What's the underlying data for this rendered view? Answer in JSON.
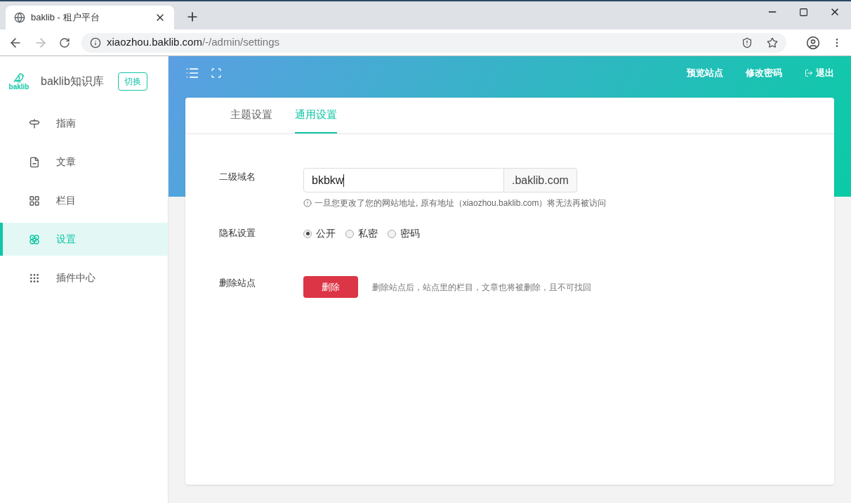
{
  "browser": {
    "tab_title": "baklib - 租户平台",
    "url_host": "xiaozhou.baklib.com",
    "url_path": "/-/admin/settings"
  },
  "sidebar": {
    "brand": "baklib知识库",
    "logo_text": "baklib",
    "switch_button": "切换",
    "items": [
      {
        "label": "指南",
        "kind": "guide",
        "selected": false
      },
      {
        "label": "文章",
        "kind": "article",
        "selected": false
      },
      {
        "label": "栏目",
        "kind": "columns",
        "selected": false
      },
      {
        "label": "设置",
        "kind": "settings",
        "selected": true
      },
      {
        "label": "插件中心",
        "kind": "plugins",
        "selected": false
      }
    ]
  },
  "header": {
    "links": [
      {
        "label": "预览站点",
        "kind": "plain"
      },
      {
        "label": "修改密码",
        "kind": "plain"
      },
      {
        "label": "退出",
        "kind": "logout"
      }
    ]
  },
  "tabs": [
    {
      "label": "主题设置",
      "selected": false
    },
    {
      "label": "通用设置",
      "selected": true
    }
  ],
  "form": {
    "domain_label": "二级域名",
    "domain_value": "bkbkw",
    "domain_suffix": ".baklib.com",
    "domain_hint": "一旦您更改了您的网站地址, 原有地址（xiaozhou.baklib.com）将无法再被访问",
    "privacy_label": "隐私设置",
    "privacy_options": [
      {
        "label": "公开",
        "selected": true
      },
      {
        "label": "私密",
        "selected": false
      },
      {
        "label": "密码",
        "selected": false
      }
    ],
    "delete_label": "删除站点",
    "delete_button": "删除",
    "delete_hint": "删除站点后，站点里的栏目，文章也将被删除，且不可找回"
  }
}
